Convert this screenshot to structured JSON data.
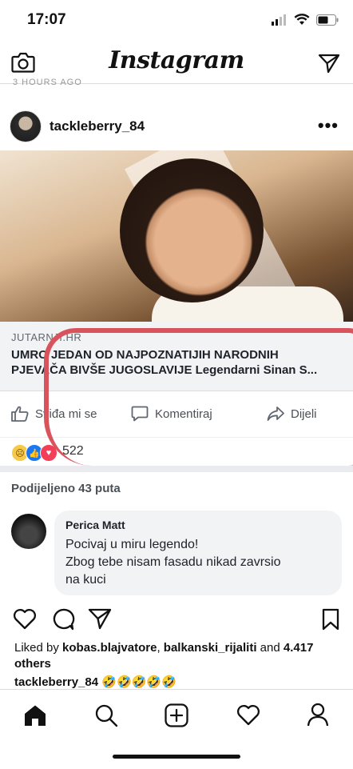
{
  "status_bar": {
    "time": "17:07"
  },
  "header": {
    "logo": "Instagram",
    "cut_text": "3 HOURS AGO"
  },
  "post": {
    "username": "tackleberry_84",
    "more": "•••",
    "screenshot": {
      "link": {
        "domain": "JUTARNJI.HR",
        "headline_line1": "UMRO JEDAN OD NAJPOZNATIJIH NARODNIH",
        "headline_line2": "PJEVAČA BIVŠE JUGOSLAVIJE Legendarni Sinan S..."
      },
      "actions": {
        "like": "Sviđa mi se",
        "comment": "Komentiraj",
        "share": "Dijeli"
      },
      "reactions": {
        "count": "522"
      },
      "shared_text": "Podijeljeno 43 puta",
      "comment": {
        "name": "Perica Matt",
        "line1": "Pocivaj u miru legendo!",
        "line2": "Zbog tebe nisam fasadu nikad zavrsio",
        "line3": "na kuci"
      }
    },
    "likes": {
      "prefix": "Liked by ",
      "user1": "kobas.blajvatore",
      "sep": ", ",
      "user2": "balkanski_rijaliti",
      "and": " and ",
      "count": "4.417",
      "others": "others"
    },
    "caption": {
      "username": "tackleberry_84",
      "emoji": "🤣🤣🤣🤣🤣"
    }
  },
  "colors": {
    "accent_red": "#d9535d",
    "fb_gray": "#e9ebee",
    "text_dark": "#1d2129"
  }
}
